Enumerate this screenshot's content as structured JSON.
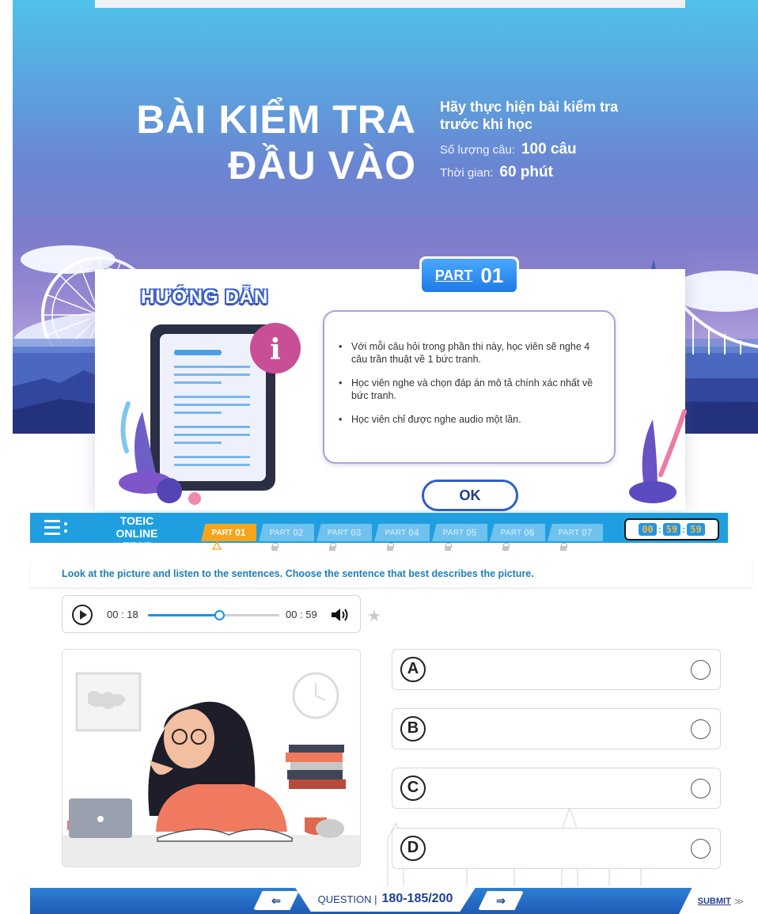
{
  "hero": {
    "title_line1": "BÀI KIỂM TRA",
    "title_line2": "ĐẦU VÀO",
    "subtitle_line1": "Hãy thực hiện bài kiểm tra",
    "subtitle_line2": "trước khi học",
    "count_label": "Số lượng câu:",
    "count_value": "100 câu",
    "time_label": "Thời gian:",
    "time_value": "60 phút"
  },
  "guide": {
    "title": "HƯỚNG DẪN",
    "part_label": "PART",
    "part_number": "01",
    "items": [
      "Với mỗi câu hỏi trong phần thi này, học viên sẽ nghe 4 câu trần thuật về 1 bức tranh.",
      "Học viên nghe và chọn đáp án mô tả chính xác nhất về bức tranh.",
      "Học viên chỉ được nghe audio một lần."
    ],
    "ok_label": "OK"
  },
  "topbar": {
    "app_line1": "TOEIC",
    "app_line2": "ONLINE TEST",
    "tabs": [
      {
        "label": "PART",
        "num": "01"
      },
      {
        "label": "PART",
        "num": "02"
      },
      {
        "label": "PART",
        "num": "03"
      },
      {
        "label": "PART",
        "num": "04"
      },
      {
        "label": "PART",
        "num": "05"
      },
      {
        "label": "PART",
        "num": "06"
      },
      {
        "label": "PART",
        "num": "07"
      }
    ],
    "timer": {
      "h": "00",
      "m": "59",
      "s": "59"
    }
  },
  "instruction": "Look at the picture and listen to the sentences. Choose the sentence that best describes the picture.",
  "player": {
    "current_time": "00 : 18",
    "total_time": "00 : 59",
    "progress": 0.54
  },
  "options": [
    "A",
    "B",
    "C",
    "D"
  ],
  "bottombar": {
    "prev_label": "⇐",
    "question_label": "QUESTION |",
    "question_value": "180-185/200",
    "next_label": "⇒",
    "submit_label": "SUBMIT",
    "submit_icon": "≫"
  },
  "colors": {
    "accent": "#1f9fe0",
    "active_tab": "#f6a51b",
    "instruction_text": "#1b7ec0"
  }
}
